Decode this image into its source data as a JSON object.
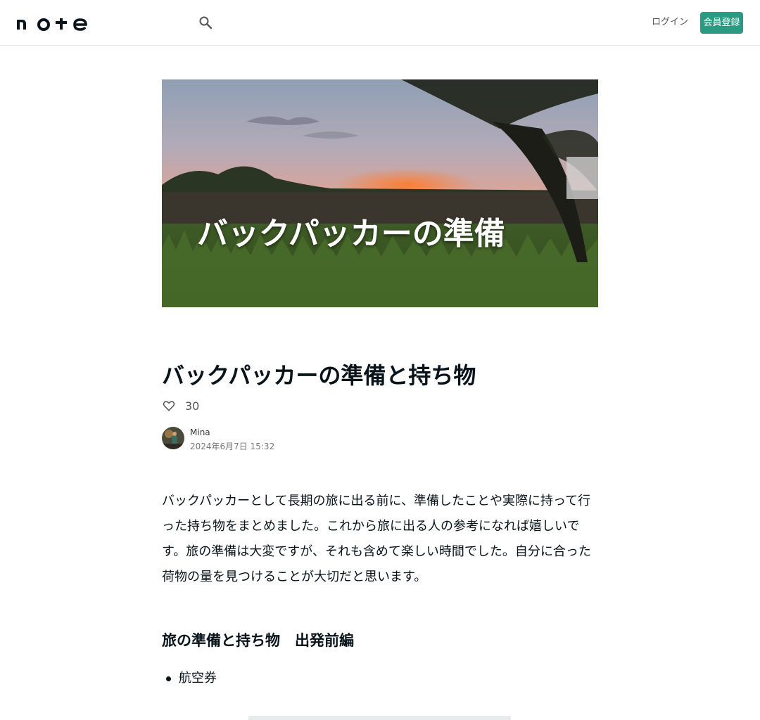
{
  "header": {
    "logo_text": "note",
    "login_label": "ログイン",
    "signup_label": "会員登録"
  },
  "hero": {
    "caption": "バックパッカーの準備"
  },
  "article": {
    "title": "バックパッカーの準備と持ち物",
    "like_count": "30",
    "author_name": "Mina",
    "date": "2024年6月7日 15:32",
    "body": "バックパッカーとして長期の旅に出る前に、準備したことや実際に持って行った持ち物をまとめました。これから旅に出る人の参考になれば嬉しいです。旅の準備は大変ですが、それも含めて楽しい時間でした。自分に合った荷物の量を見つけることが大切だと思います。",
    "section_heading": "旅の準備と持ち物　出発前編",
    "list_items": [
      "航空券"
    ]
  },
  "colors": {
    "accent": "#2b9a82",
    "text": "#08131a"
  }
}
